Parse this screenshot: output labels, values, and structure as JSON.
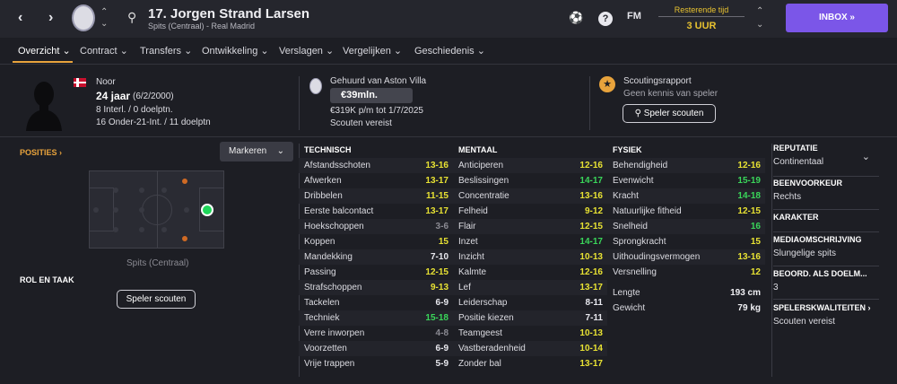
{
  "header": {
    "player_name": "17. Jorgen Strand Larsen",
    "player_sub": "Spits (Centraal) - Real Madrid",
    "fm_label": "FM",
    "time_label": "Resterende tijd",
    "time_value": "3 UUR",
    "inbox_label": "INBOX »"
  },
  "tabs": [
    {
      "label": "Overzicht ⌄"
    },
    {
      "label": "Contract ⌄"
    },
    {
      "label": "Transfers ⌄"
    },
    {
      "label": "Ontwikkeling ⌄"
    },
    {
      "label": "Verslagen ⌄"
    },
    {
      "label": "Vergelijken ⌄"
    },
    {
      "label": "Geschiedenis ⌄"
    }
  ],
  "profile": {
    "nationality": "Noor",
    "age": "24 jaar",
    "dob": "(6/2/2000)",
    "caps": "8 Interl. / 0 doelptn.",
    "u21": "16 Onder-21-Int. / 11 doelptn"
  },
  "loan": {
    "title": "Gehuurd van Aston Villa",
    "value": "€39mln.",
    "wage": "€319K p/m tot 1/7/2025",
    "scouts": "Scouten vereist"
  },
  "scouting": {
    "title": "Scoutingsrapport",
    "sub": "Geen kennis van speler",
    "button": "Speler scouten"
  },
  "positions": {
    "label": "POSITIES ›",
    "marker_button": "Markeren",
    "position_name": "Spits (Centraal)",
    "role_label": "ROL EN TAAK",
    "scout_button": "Speler scouten"
  },
  "attributes": {
    "technical_title": "TECHNISCH",
    "technical": [
      [
        "Afstandsschoten",
        "13-16"
      ],
      [
        "Afwerken",
        "13-17"
      ],
      [
        "Dribbelen",
        "11-15"
      ],
      [
        "Eerste balcontact",
        "13-17"
      ],
      [
        "Hoekschoppen",
        "3-6"
      ],
      [
        "Koppen",
        "15"
      ],
      [
        "Mandekking",
        "7-10"
      ],
      [
        "Passing",
        "12-15"
      ],
      [
        "Strafschoppen",
        "9-13"
      ],
      [
        "Tackelen",
        "6-9"
      ],
      [
        "Techniek",
        "15-18"
      ],
      [
        "Verre inworpen",
        "4-8"
      ],
      [
        "Voorzetten",
        "6-9"
      ],
      [
        "Vrije trappen",
        "5-9"
      ]
    ],
    "mental_title": "MENTAAL",
    "mental": [
      [
        "Anticiperen",
        "12-16"
      ],
      [
        "Beslissingen",
        "14-17"
      ],
      [
        "Concentratie",
        "13-16"
      ],
      [
        "Felheid",
        "9-12"
      ],
      [
        "Flair",
        "12-15"
      ],
      [
        "Inzet",
        "14-17"
      ],
      [
        "Inzicht",
        "10-13"
      ],
      [
        "Kalmte",
        "12-16"
      ],
      [
        "Lef",
        "13-17"
      ],
      [
        "Leiderschap",
        "8-11"
      ],
      [
        "Positie kiezen",
        "7-11"
      ],
      [
        "Teamgeest",
        "10-13"
      ],
      [
        "Vastberadenheid",
        "10-14"
      ],
      [
        "Zonder bal",
        "13-17"
      ]
    ],
    "physical_title": "FYSIEK",
    "physical": [
      [
        "Behendigheid",
        "12-16"
      ],
      [
        "Evenwicht",
        "15-19"
      ],
      [
        "Kracht",
        "14-18"
      ],
      [
        "Natuurlijke fitheid",
        "12-15"
      ],
      [
        "Snelheid",
        "16"
      ],
      [
        "Sprongkracht",
        "15"
      ],
      [
        "Uithoudingsvermogen",
        "13-16"
      ],
      [
        "Versnelling",
        "12"
      ]
    ],
    "extra": [
      [
        "Lengte",
        "193 cm"
      ],
      [
        "Gewicht",
        "79 kg"
      ]
    ]
  },
  "right": {
    "reputation_title": "REPUTATIE",
    "reputation": "Continentaal",
    "foot_title": "BEENVOORKEUR",
    "foot": "Rechts",
    "character_title": "KARAKTER",
    "media_title": "MEDIAOMSCHRIJVING",
    "media": "Slungelige spits",
    "rating_title": "BEOORD. ALS DOELM...",
    "rating": "3",
    "qualities_title": "SPELERSKWALITEITEN ›",
    "qualities": "Scouten vereist"
  },
  "colors": {
    "accent": "#e8a33c",
    "inbox": "#7b56e8",
    "value_yellow": "#e8e233",
    "value_green": "#3ad65a",
    "value_grey": "#8a8a92"
  }
}
